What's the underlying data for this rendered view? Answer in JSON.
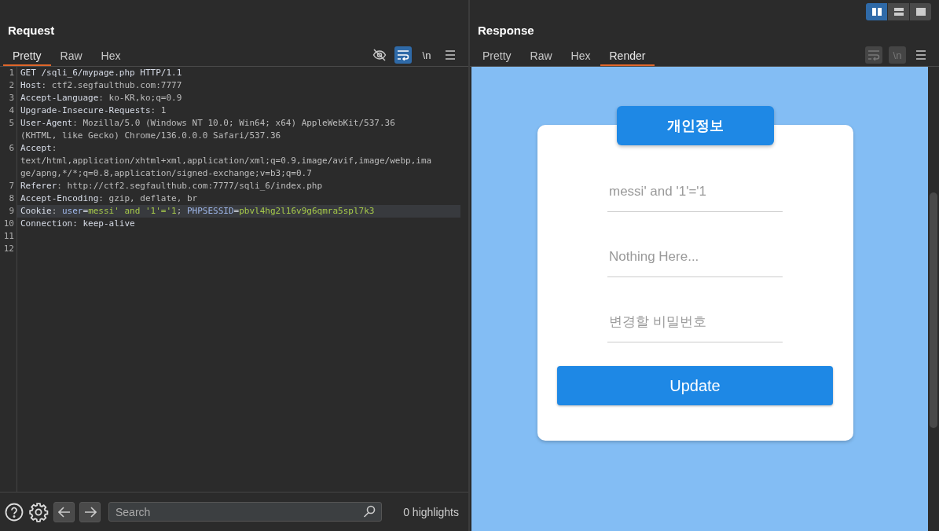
{
  "layout_toggle": [
    {
      "kind": "columns",
      "selected": true
    },
    {
      "kind": "rows",
      "selected": false
    },
    {
      "kind": "single",
      "selected": false
    }
  ],
  "request": {
    "title": "Request",
    "tabs": [
      {
        "label": "Pretty",
        "selected": true
      },
      {
        "label": "Raw",
        "selected": false
      },
      {
        "label": "Hex",
        "selected": false
      }
    ],
    "tools": [
      {
        "kind": "eye-off",
        "on": false
      },
      {
        "kind": "wrap",
        "on": true
      },
      {
        "kind": "newline",
        "text": "\\n",
        "on": false
      },
      {
        "kind": "menu",
        "on": false
      }
    ],
    "lines": [
      {
        "number": "1",
        "highlighted": false,
        "rows": [
          [
            {
              "text": "GET /sqli_6/mypage.php HTTP/1.1",
              "kind": "name"
            }
          ]
        ]
      },
      {
        "number": "2",
        "highlighted": false,
        "rows": [
          [
            {
              "text": "Host",
              "kind": "name"
            },
            {
              "text": ": ctf2.segfaulthub.com:7777",
              "kind": "value"
            }
          ]
        ]
      },
      {
        "number": "3",
        "highlighted": false,
        "rows": [
          [
            {
              "text": "Accept-Language",
              "kind": "name"
            },
            {
              "text": ": ko-KR,ko;q=0.9",
              "kind": "value"
            }
          ]
        ]
      },
      {
        "number": "4",
        "highlighted": false,
        "rows": [
          [
            {
              "text": "Upgrade-Insecure-Requests",
              "kind": "name"
            },
            {
              "text": ": 1",
              "kind": "value"
            }
          ]
        ]
      },
      {
        "number": "5",
        "highlighted": false,
        "rows": [
          [
            {
              "text": "User-Agent",
              "kind": "name"
            },
            {
              "text": ": Mozilla/5.0 (Windows NT 10.0; Win64; x64) AppleWebKit/537.36",
              "kind": "value"
            }
          ],
          [
            {
              "text": "(KHTML, like Gecko) Chrome/136.0.0.0 Safari/537.36",
              "kind": "value"
            }
          ]
        ]
      },
      {
        "number": "6",
        "highlighted": false,
        "rows": [
          [
            {
              "text": "Accept",
              "kind": "name"
            },
            {
              "text": ":",
              "kind": "value"
            }
          ],
          [
            {
              "text": "text/html,application/xhtml+xml,application/xml;q=0.9,image/avif,image/webp,ima",
              "kind": "value"
            }
          ],
          [
            {
              "text": "ge/apng,*/*;q=0.8,application/signed-exchange;v=b3;q=0.7",
              "kind": "value"
            }
          ]
        ]
      },
      {
        "number": "7",
        "highlighted": false,
        "rows": [
          [
            {
              "text": "Referer",
              "kind": "name"
            },
            {
              "text": ": http://ctf2.segfaulthub.com:7777/sqli_6/index.php",
              "kind": "value"
            }
          ]
        ]
      },
      {
        "number": "8",
        "highlighted": false,
        "rows": [
          [
            {
              "text": "Accept-Encoding",
              "kind": "name"
            },
            {
              "text": ": gzip, deflate, br",
              "kind": "value"
            }
          ]
        ]
      },
      {
        "number": "9",
        "highlighted": true,
        "rows": [
          [
            {
              "text": "Cookie",
              "kind": "name"
            },
            {
              "text": ": ",
              "kind": "value"
            },
            {
              "text": "user",
              "kind": "param"
            },
            {
              "text": "=",
              "kind": "name"
            },
            {
              "text": "messi' and '1'='1",
              "kind": "green"
            },
            {
              "text": "; ",
              "kind": "value"
            },
            {
              "text": "PHPSESSID",
              "kind": "param"
            },
            {
              "text": "=",
              "kind": "name"
            },
            {
              "text": "pbvl4hg2l16v9g6qmra5spl7k3",
              "kind": "green"
            }
          ]
        ]
      },
      {
        "number": "10",
        "highlighted": false,
        "rows": [
          [
            {
              "text": "Connection: keep-alive",
              "kind": "name"
            }
          ]
        ]
      },
      {
        "number": "11",
        "highlighted": false,
        "rows": [
          []
        ]
      },
      {
        "number": "12",
        "highlighted": false,
        "rows": [
          []
        ]
      }
    ],
    "footer": {
      "search": {
        "placeholder": "Search"
      },
      "highlights": "0 highlights"
    }
  },
  "response": {
    "title": "Response",
    "tabs": [
      {
        "label": "Pretty",
        "selected": false
      },
      {
        "label": "Raw",
        "selected": false
      },
      {
        "label": "Hex",
        "selected": false
      },
      {
        "label": "Render",
        "selected": true
      }
    ],
    "tools": [
      {
        "kind": "wrap",
        "disabled": true
      },
      {
        "kind": "newline",
        "text": "\\n",
        "disabled": true
      },
      {
        "kind": "menu",
        "disabled": false
      }
    ],
    "render": {
      "heading": "개인정보",
      "fields": [
        {
          "value": "messi' and '1'='1"
        },
        {
          "placeholder": "Nothing Here..."
        },
        {
          "placeholder": "변경할 비밀번호"
        }
      ],
      "button": "Update"
    }
  }
}
